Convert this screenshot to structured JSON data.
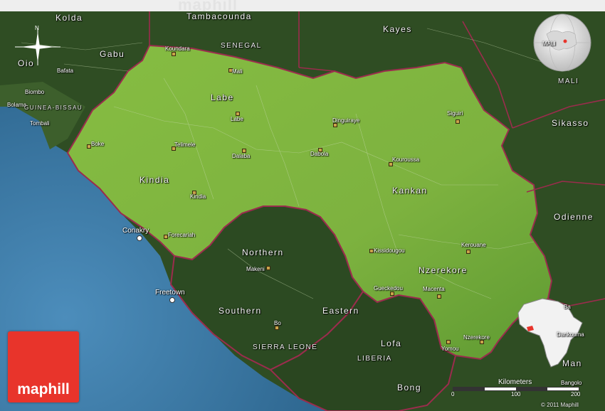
{
  "watermark": "maphill",
  "logo": {
    "text": "maphill"
  },
  "copyright": "© 2011 Maphill",
  "scale": {
    "title": "Kilometers",
    "ticks": [
      "0",
      "100",
      "200"
    ]
  },
  "colors": {
    "ocean": "#3f7aa8",
    "guinea": "#7bb33d",
    "neighbors": "#2f4d23",
    "border": "#9b2c4d",
    "logo": "#e8342b"
  },
  "icons": {
    "compass": "compass-rose-icon",
    "globe": "locator-globe-icon",
    "inset": "africa-inset-icon"
  },
  "regions": {
    "labe": "Labe",
    "kindia": "Kindia",
    "kankan": "Kankan",
    "nzerekore": "Nzerekore",
    "northern": "Northern",
    "southern": "Southern",
    "eastern": "Eastern",
    "lofa": "Lofa",
    "bong": "Bong",
    "kolda": "Kolda",
    "gabu": "Gabu",
    "tambacounda": "Tambacounda",
    "kayes": "Kayes",
    "sikasso": "Sikasso",
    "odienne": "Odienne",
    "man": "Man",
    "oio": "Oio",
    "bafata": "Bafata",
    "tombali": "Tombali",
    "bolama": "Bolama",
    "biombo": "Biombo",
    "ba": "Ba",
    "dankouma": "Dankouma"
  },
  "countries": {
    "senegal": "SENEGAL",
    "mali": "MALI",
    "guinea_bissau": "GUINEA-BISSAU",
    "sierra_leone": "SIERRA LEONE",
    "liberia": "LIBERIA",
    "mali_small": "MALI"
  },
  "cities": {
    "koundara": "Koundara",
    "mali_town": "Mali",
    "labe": "Labe",
    "telimele": "Telimele",
    "boke": "Boke",
    "dalaba": "Dalaba",
    "dinguiraye": "Dinguiraye",
    "dabola": "Dabola",
    "siguiri": "Siguiri",
    "kouroussa": "Kouroussa",
    "kindia": "Kindia",
    "forecariah": "Forecariah",
    "kerouane": "Kerouane",
    "kissidougou": "Kissidougou",
    "gueckedou": "Gueckedou",
    "macenta": "Macenta",
    "nzerekore": "Nzerekore",
    "yomou": "Yomou",
    "makeni": "Makeni",
    "bo": "Bo",
    "bangolo": "Bangolo"
  },
  "capitals": {
    "conakry": "Conakry",
    "freetown": "Freetown"
  }
}
